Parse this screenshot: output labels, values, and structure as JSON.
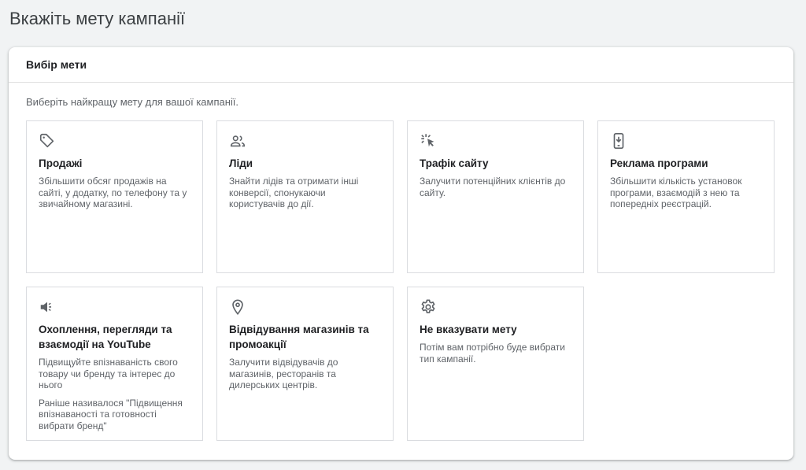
{
  "page": {
    "title": "Вкажіть мету кампанії"
  },
  "panel": {
    "header": "Вибір мети",
    "subtitle": "Виберіть найкращу мету для вашої кампанії."
  },
  "goals": [
    {
      "icon": "tag-icon",
      "title": "Продажі",
      "description": "Збільшити обсяг продажів на сайті, у додатку, по телефону та у звичайному магазині."
    },
    {
      "icon": "people-icon",
      "title": "Ліди",
      "description": "Знайти лідів та отримати інші конверсії, спонукаючи користувачів до дії."
    },
    {
      "icon": "cursor-click-icon",
      "title": "Трафік сайту",
      "description": "Залучити потенційних клієнтів до сайту."
    },
    {
      "icon": "mobile-app-icon",
      "title": "Реклама програми",
      "description": "Збільшити кількість установок програми, взаємодій з нею та попередніх реєстрацій."
    },
    {
      "icon": "megaphone-icon",
      "title": "Охоплення, перегляди та взаємодії на YouTube",
      "description": "Підвищуйте впізнаваність свого товару чи бренду та інтерес до нього",
      "note": "Раніше називалося \"Підвищення впізнаваності та готовності вибрати бренд\""
    },
    {
      "icon": "location-pin-icon",
      "title": "Відвідування магазинів та промоакції",
      "description": "Залучити відвідувачів до магазинів, ресторанів та дилерських центрів."
    },
    {
      "icon": "gear-icon",
      "title": "Не вказувати мету",
      "description": "Потім вам потрібно буде вибрати тип кампанії."
    }
  ],
  "colors": {
    "background": "#f1f3f4",
    "card_border": "#dadce0",
    "icon": "#5f6368"
  }
}
